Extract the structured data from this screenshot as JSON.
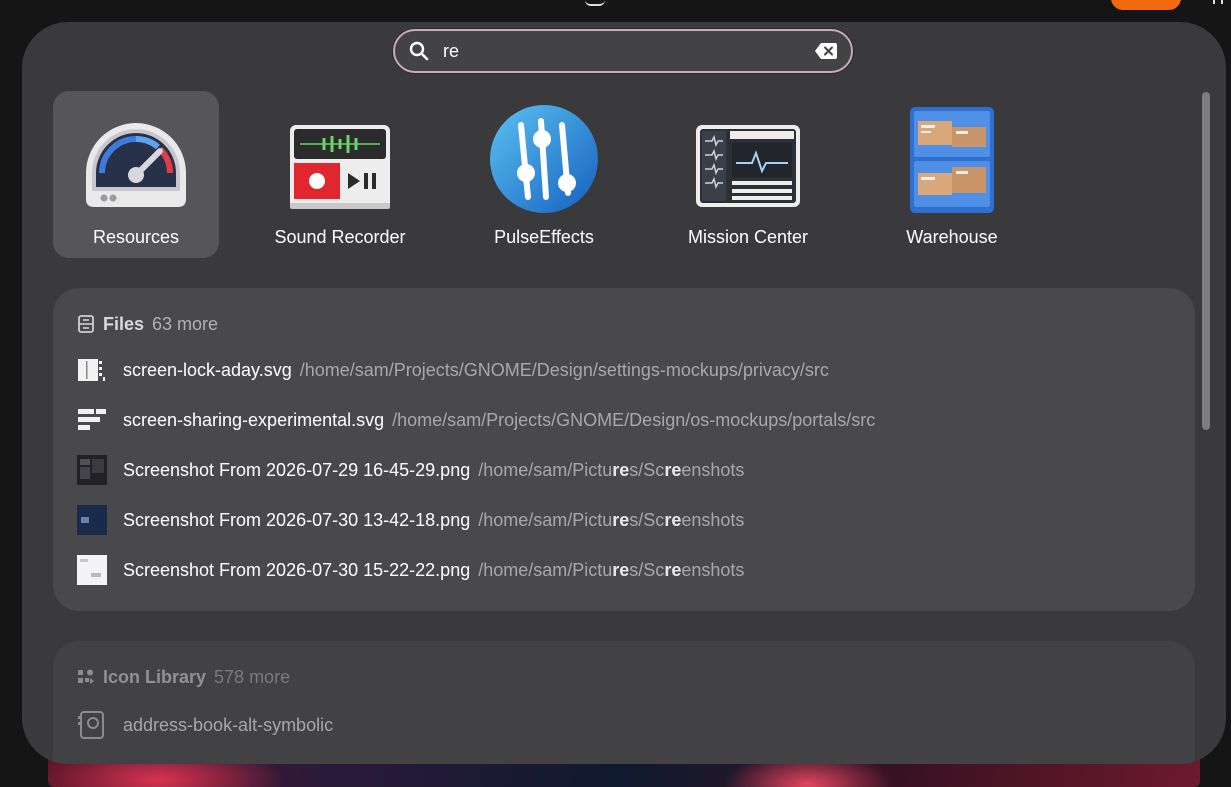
{
  "search": {
    "value": "re",
    "placeholder": ""
  },
  "apps": [
    {
      "label": "Resources",
      "icon": "resources-gauge-icon",
      "selected": true
    },
    {
      "label": "Sound Recorder",
      "icon": "sound-recorder-icon"
    },
    {
      "label": "PulseEffects",
      "icon": "pulseeffects-sliders-icon"
    },
    {
      "label": "Mission Center",
      "icon": "mission-center-monitor-icon"
    },
    {
      "label": "Warehouse",
      "icon": "warehouse-cabinet-icon"
    }
  ],
  "files": {
    "title": "Files",
    "more": "63 more",
    "results": [
      {
        "name": "screen-lock-aday.svg",
        "path": "/home/sam/Projects/GNOME/Design/settings-mockups/privacy/src"
      },
      {
        "name": "screen-sharing-experimental.svg",
        "path": "/home/sam/Projects/GNOME/Design/os-mockups/portals/src"
      },
      {
        "name": "Screenshot From 2026-07-29 16-45-29.png",
        "path_pre": "/home/sam/Pictu",
        "path_hl1": "re",
        "path_mid": "s/Sc",
        "path_hl2": "re",
        "path_post": "enshots"
      },
      {
        "name": "Screenshot From 2026-07-30 13-42-18.png",
        "path_pre": "/home/sam/Pictu",
        "path_hl1": "re",
        "path_mid": "s/Sc",
        "path_hl2": "re",
        "path_post": "enshots"
      },
      {
        "name": "Screenshot From 2026-07-30 15-22-22.png",
        "path_pre": "/home/sam/Pictu",
        "path_hl1": "re",
        "path_mid": "s/Sc",
        "path_hl2": "re",
        "path_post": "enshots"
      }
    ]
  },
  "icon_library": {
    "title": "Icon Library",
    "more": "578 more",
    "results": [
      {
        "name": "address-book-alt-symbolic"
      }
    ]
  },
  "colors": {
    "panel": "#3a3a3d",
    "card": "#49494c",
    "selected": "#56565a",
    "search_border": "#c8a9c0",
    "accent_orange": "#f26a0d"
  }
}
